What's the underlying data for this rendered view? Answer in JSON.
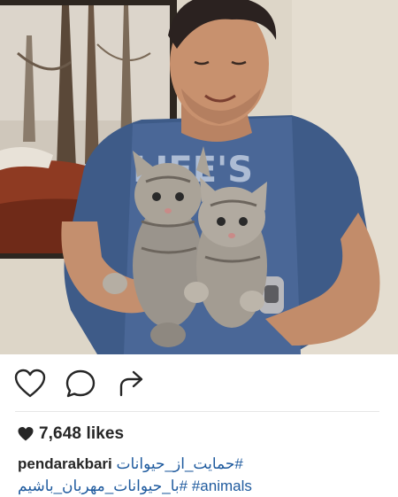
{
  "post": {
    "username": "pendarakbari",
    "likes_count": "7,648",
    "likes_label": "likes",
    "caption_tags": [
      "#حمایت_از_حیوانات",
      "#با_حیوانات_مهربان_باشیم",
      "#animals"
    ],
    "photo_subject": "man holding two kittens"
  },
  "actions": {
    "like_icon": "heart-outline-icon",
    "comment_icon": "comment-bubble-icon",
    "share_icon": "share-arrow-icon"
  },
  "colors": {
    "hashtag": "#1e5a9e",
    "text": "#262626",
    "divider": "#e6e6e6",
    "shirt": "#3d5a8a",
    "wall": "#ddd5c6"
  }
}
